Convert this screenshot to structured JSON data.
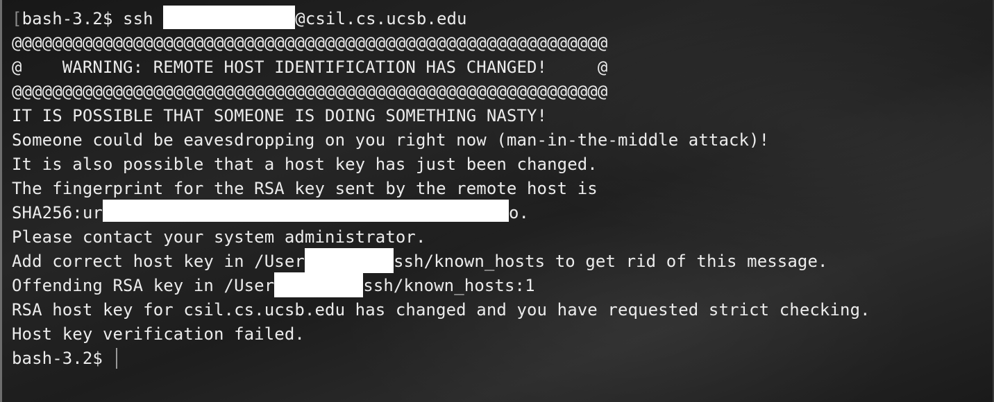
{
  "terminal": {
    "lines": [
      {
        "prefix": "bash-3.2$ ssh ",
        "suffix": "@csil.cs.ucsb.edu"
      },
      {
        "text": "@@@@@@@@@@@@@@@@@@@@@@@@@@@@@@@@@@@@@@@@@@@@@@@@@@@@@@@@@@@"
      },
      {
        "text": "@    WARNING: REMOTE HOST IDENTIFICATION HAS CHANGED!     @"
      },
      {
        "text": "@@@@@@@@@@@@@@@@@@@@@@@@@@@@@@@@@@@@@@@@@@@@@@@@@@@@@@@@@@@"
      },
      {
        "text": "IT IS POSSIBLE THAT SOMEONE IS DOING SOMETHING NASTY!"
      },
      {
        "text": "Someone could be eavesdropping on you right now (man-in-the-middle attack)!"
      },
      {
        "text": "It is also possible that a host key has just been changed."
      },
      {
        "text": "The fingerprint for the RSA key sent by the remote host is"
      },
      {
        "prefix": "SHA256:ur",
        "suffix": "o."
      },
      {
        "text": "Please contact your system administrator."
      },
      {
        "prefix": "Add correct host key in /User",
        "suffix": "ssh/known_hosts to get rid of this message."
      },
      {
        "prefix": "Offending RSA key in /User",
        "suffix": "ssh/known_hosts:1"
      },
      {
        "text": "RSA host key for csil.cs.ucsb.edu has changed and you have requested strict checking."
      },
      {
        "text": "Host key verification failed."
      },
      {
        "prompt": "bash-3.2$ "
      }
    ]
  }
}
